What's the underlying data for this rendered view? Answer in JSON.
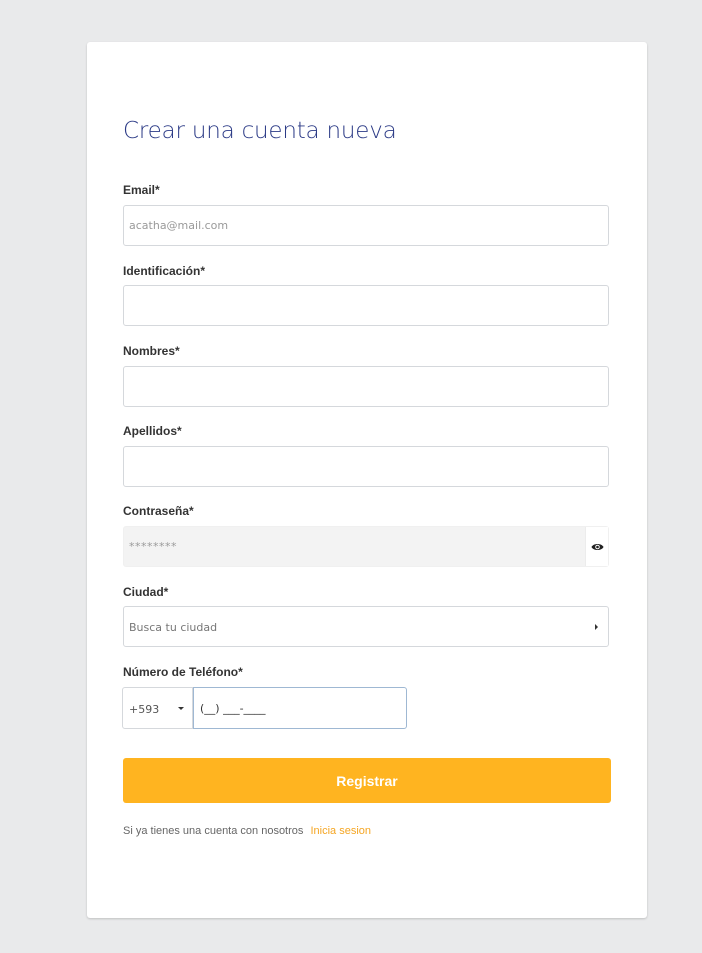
{
  "form": {
    "title": "Crear una cuenta nueva",
    "email": {
      "label": "Email*",
      "placeholder": "acatha@mail.com",
      "value": ""
    },
    "identification": {
      "label": "Identificación*",
      "value": ""
    },
    "names": {
      "label": "Nombres*",
      "value": ""
    },
    "surnames": {
      "label": "Apellidos*",
      "value": ""
    },
    "password": {
      "label": "Contraseña*",
      "placeholder": "********",
      "toggle_icon": "eye-icon"
    },
    "city": {
      "label": "Ciudad*",
      "placeholder": "Busca tu ciudad"
    },
    "phone": {
      "label": "Número de Teléfono*",
      "country_code": "+593",
      "mask": "(__) ___-____"
    },
    "submit_label": "Registrar",
    "footer": {
      "text": "Si ya tienes una cuenta con nosotros",
      "link": "Inicia sesion"
    }
  },
  "colors": {
    "background": "#e9eaeb",
    "title": "#2b3a86",
    "button": "#ffb420",
    "link": "#f5a623"
  }
}
